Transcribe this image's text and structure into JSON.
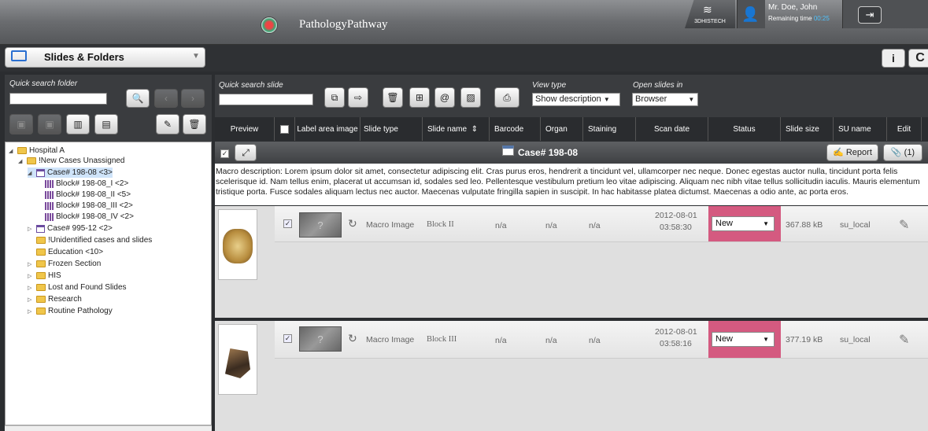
{
  "header": {
    "app_title": "PathologyPathway",
    "vendor": "3DHISTECH",
    "user_name": "Mr. Doe, John",
    "remaining_label": "Remaining time",
    "remaining_time": "00:25"
  },
  "panel": {
    "title": "Slides & Folders"
  },
  "folder_search": {
    "label": "Quick search folder",
    "value": ""
  },
  "slide_search": {
    "label": "Quick search slide",
    "value": ""
  },
  "view_type": {
    "label": "View type",
    "selected": "Show description"
  },
  "open_in": {
    "label": "Open slides in",
    "selected": "Browser"
  },
  "tree": [
    {
      "label": "Hospital A",
      "icon": "folder",
      "expanded": true
    },
    {
      "label": "!New Cases Unassigned",
      "icon": "folder",
      "expanded": true
    },
    {
      "label": "Case# 198-08 <3>",
      "icon": "case",
      "expanded": true,
      "selected": true
    },
    {
      "label": "Block# 198-08_I <2>",
      "icon": "block"
    },
    {
      "label": "Block# 198-08_II <5>",
      "icon": "block"
    },
    {
      "label": "Block# 198-08_III <2>",
      "icon": "block"
    },
    {
      "label": "Block# 198-08_IV <2>",
      "icon": "block"
    },
    {
      "label": "Case# 995-12 <2>",
      "icon": "case",
      "expanded": false
    },
    {
      "label": "!Unidentified cases and slides",
      "icon": "folder"
    },
    {
      "label": "Education <10>",
      "icon": "folder"
    },
    {
      "label": "Frozen Section",
      "icon": "folder",
      "expanded": false
    },
    {
      "label": "HIS",
      "icon": "folder",
      "expanded": false
    },
    {
      "label": "Lost and Found Slides",
      "icon": "folder",
      "expanded": false
    },
    {
      "label": "Research",
      "icon": "folder",
      "expanded": false
    },
    {
      "label": "Routine Pathology",
      "icon": "folder",
      "expanded": false
    }
  ],
  "columns": [
    "Preview",
    "Label area image",
    "Slide type",
    "Slide name",
    "Barcode",
    "Organ",
    "Staining",
    "Scan date",
    "Status",
    "Slide size",
    "SU name",
    "Edit"
  ],
  "case": {
    "title": "Case# 198-08",
    "report_label": "Report",
    "attachments": "(1)",
    "macro_description": "Macro description:  Lorem ipsum dolor sit amet, consectetur adipiscing elit. Cras purus eros, hendrerit a tincidunt vel, ullamcorper nec neque. Donec egestas auctor nulla, tincidunt porta felis scelerisque id. Nam tellus enim, placerat ut accumsan id, sodales sed leo. Pellentesque vestibulum pretium leo vitae adipiscing. Aliquam nec nibh vitae tellus sollicitudin iaculis. Mauris elementum tristique porta. Fusce sodales aliquam lectus nec auctor. Maecenas vulputate fringilla sapien in suscipit. In hac habitasse platea dictumst. Maecenas a odio ante, ac porta eros."
  },
  "slides": [
    {
      "slide_type": "Macro Image",
      "slide_name": "Block II",
      "barcode": "n/a",
      "organ": "n/a",
      "staining": "n/a",
      "scan_date": "2012-08-01",
      "scan_time": "03:58:30",
      "status": "New",
      "size": "367.88 kB",
      "su_name": "su_local",
      "label_placeholder": "?"
    },
    {
      "slide_type": "Macro Image",
      "slide_name": "Block III",
      "barcode": "n/a",
      "organ": "n/a",
      "staining": "n/a",
      "scan_date": "2012-08-01",
      "scan_time": "03:58:16",
      "status": "New",
      "size": "377.19 kB",
      "su_name": "su_local",
      "label_placeholder": "?"
    }
  ],
  "colors": {
    "status_bg": "#d45a80",
    "accent": "#2a6fd0"
  }
}
